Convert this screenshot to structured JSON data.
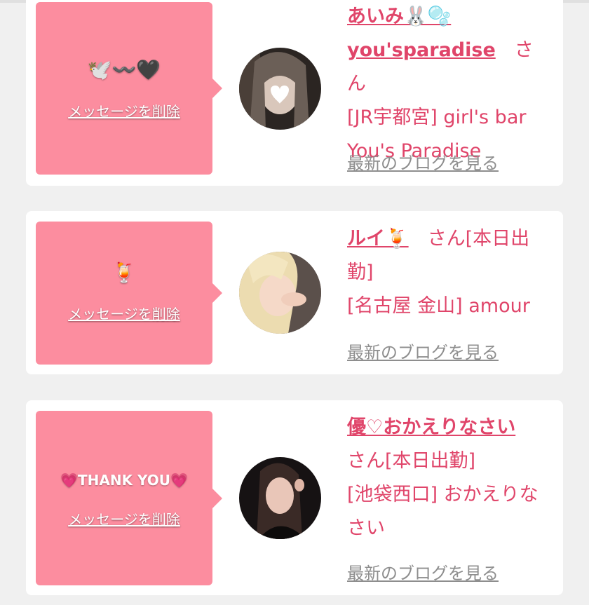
{
  "cards": [
    {
      "message": "🕊️〰️🖤",
      "delete_label": "メッセージを削除",
      "name": "あいみ🐰🫧",
      "name_line2": "you'sparadise",
      "honorific": "さん",
      "shop": "[JR宇都宮] girl's bar You's Paradise",
      "blog_link": "最新のブログを見る"
    },
    {
      "message": "🍹",
      "delete_label": "メッセージを削除",
      "name": "ルイ🍹",
      "honorific": "さん[本日出勤]",
      "shop": "[名古屋 金山] amour",
      "blog_link": "最新のブログを見る"
    },
    {
      "message": "💗THANK YOU💗",
      "delete_label": "メッセージを削除",
      "name": "優♡おかえりなさい",
      "honorific": "さん[本日出勤]",
      "shop": "[池袋西口] おかえりなさい",
      "blog_link": "最新のブログを見る"
    }
  ],
  "colors": {
    "accent": "#e0456a",
    "message_box": "#fc8d9f",
    "link_gray": "#8e8e8e",
    "background": "#f0f0f0"
  }
}
